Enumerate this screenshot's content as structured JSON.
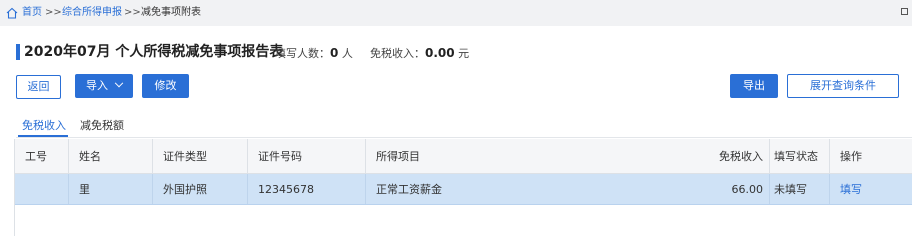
{
  "breadcrumb": {
    "home": "首页",
    "sep1": ">>",
    "level2": "综合所得申报",
    "sep2": ">>",
    "current": "减免事项附表"
  },
  "header": {
    "title": "2020年07月  个人所得税减免事项报告表",
    "filled_label": "填写人数：",
    "filled_value": "0",
    "filled_unit": "人",
    "income_label": "免税收入：",
    "income_value": "0.00",
    "income_unit": "元"
  },
  "toolbar": {
    "back_label": "返回",
    "import_label": "导入",
    "edit_label": "修改",
    "export_label": "导出",
    "expand_label": "展开查询条件"
  },
  "tabs": [
    {
      "label": "免税收入",
      "active": true
    },
    {
      "label": "减免税额",
      "active": false
    }
  ],
  "table": {
    "columns": [
      "工号",
      "姓名",
      "证件类型",
      "证件号码",
      "所得项目",
      "免税收入",
      "填写状态",
      "操作"
    ],
    "rows": [
      {
        "id": "",
        "name": "里",
        "doc_type": "外国护照",
        "doc_number": "12345678",
        "income_item": "正常工资薪金",
        "tax_free_income": "66.00",
        "status": "未填写",
        "action": "填写"
      }
    ]
  },
  "colors": {
    "accent": "#2a6fd6",
    "selected_row": "#cfe2f6",
    "header_bg": "#f5f6f8"
  },
  "icons": {
    "home": "home-icon",
    "window": "restore-icon",
    "dropdown": "chevron-down-icon"
  }
}
